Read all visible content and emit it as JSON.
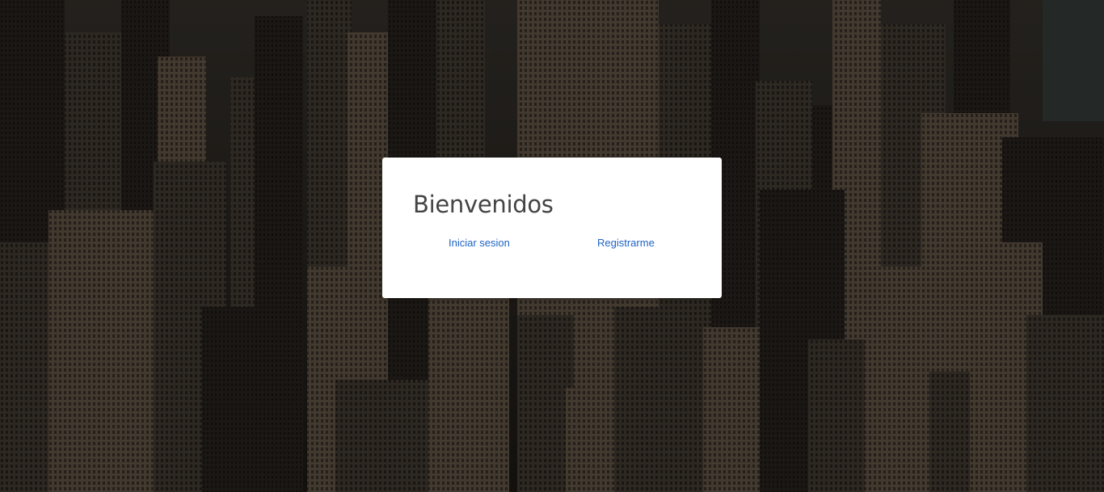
{
  "background": {
    "description_icon": "city-skyline-photo",
    "overlay_color": "#000000"
  },
  "welcome_card": {
    "title": "Bienvenidos",
    "login_link": "Iniciar sesion",
    "register_link": "Registrarme",
    "link_color": "#1e63c7",
    "title_color": "#444444"
  }
}
